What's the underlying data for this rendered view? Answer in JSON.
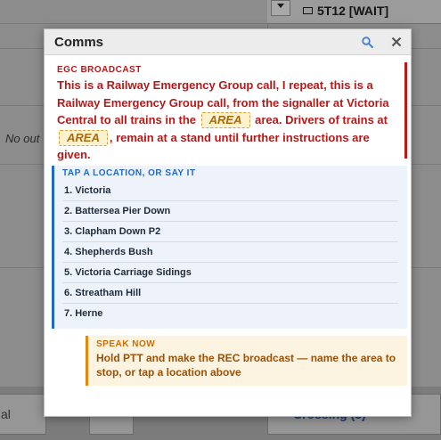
{
  "background": {
    "train_tag": "5T12 [WAIT]",
    "no_output_text": "No out",
    "bottom_tab_left": "al",
    "bottom_tab_right": "Crossing (3)"
  },
  "modal": {
    "title": "Comms",
    "search_icon": "search-icon",
    "close_icon": "close-icon"
  },
  "egc": {
    "label": "EGC BROADCAST",
    "text_part1": "This is a Railway Emergency Group call, I repeat, this is a Railway Emergency Group call, from the signaller at Victoria Central to all trains in the",
    "area_chip_1": "AREA",
    "text_part2": "area. Drivers of trains at",
    "area_chip_2": "AREA",
    "text_part3": ", remain at a stand until further instructions are given."
  },
  "locations": {
    "label": "TAP A LOCATION, OR SAY IT",
    "items": [
      "1. Victoria",
      "2. Battersea Pier Down",
      "3. Clapham Down P2",
      "4. Shepherds Bush",
      "5. Victoria Carriage Sidings",
      "6. Streatham Hill",
      "7. Herne"
    ]
  },
  "speak": {
    "label": "SPEAK NOW",
    "text": "Hold PTT and make the REC broadcast — name the area to stop, or tap a location above"
  },
  "colors": {
    "egc": "#b51a1a",
    "location_accent": "#1f6ac6",
    "speak_accent": "#e08a12",
    "area_chip_bg": "#fdf2d0"
  }
}
